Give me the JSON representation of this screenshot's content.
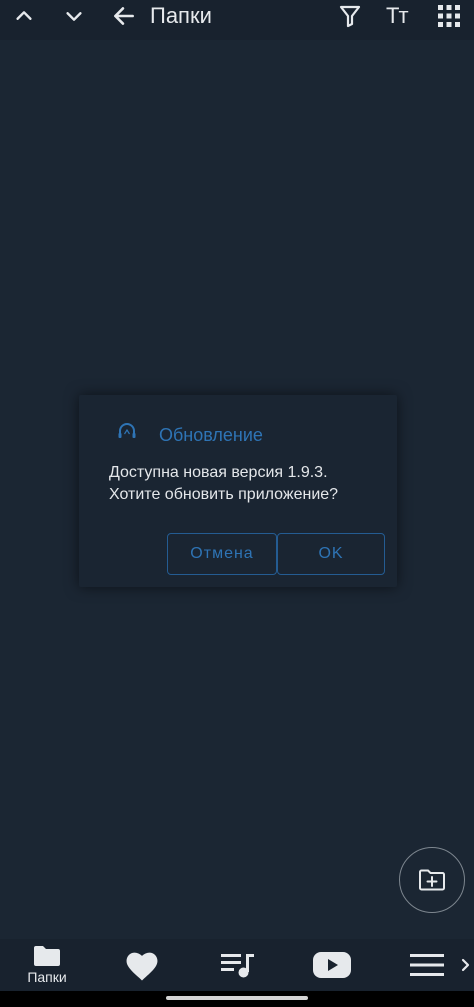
{
  "toolbar": {
    "title": "Папки",
    "text_size_label": "Тт",
    "icons": [
      "chevron-up-icon",
      "chevron-down-icon",
      "arrow-left-icon",
      "filter-icon",
      "text-size-icon",
      "grid-icon"
    ]
  },
  "dialog": {
    "title": "Обновление",
    "icon": "headphones-icon",
    "message_lines": [
      "Доступна новая версия 1.9.3.",
      "Хотите обновить приложение?"
    ],
    "cancel_label": "Отмена",
    "ok_label": "OK"
  },
  "fab": {
    "icon": "folder-add-icon"
  },
  "bottom_nav": {
    "items": [
      {
        "label": "Папки",
        "icon": "folder-icon",
        "active": true
      },
      {
        "icon": "heart-icon"
      },
      {
        "icon": "playlist-icon"
      },
      {
        "icon": "youtube-icon"
      },
      {
        "icon": "menu-icon"
      }
    ],
    "more_icon": "chevron-right-icon"
  },
  "colors": {
    "background": "#1b2633",
    "toolbar": "#18222e",
    "accent": "#2e74b5",
    "text": "#e6e9ec"
  }
}
